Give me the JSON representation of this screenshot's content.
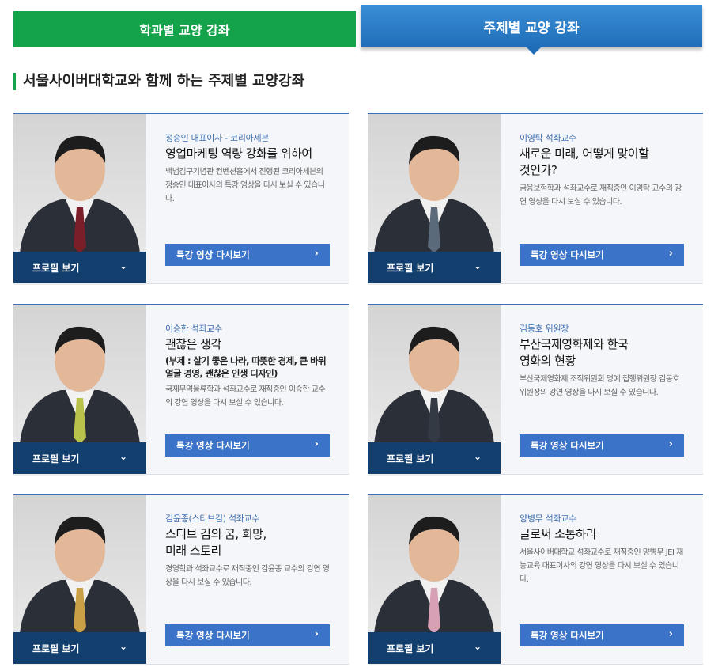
{
  "tabs": {
    "department": "학과별 교양 강좌",
    "topic": "주제별 교양 강좌"
  },
  "section_title": "서울사이버대학교와 함께 하는 주제별 교양강좌",
  "colors": {
    "green": "#14a24a",
    "blue": "#2d7cc5",
    "navy": "#123f6e",
    "button": "#3a73c8"
  },
  "cards": [
    {
      "speaker": "정승인 대표이사 - 코리아세븐",
      "title": "영업마케팅 역량 강화를 위하여",
      "subtitle": "",
      "description": "백범김구기념관 컨벤션홀에서 진행된 코리아세븐의 정승인 대표이사의 특강 영상을 다시 보실 수 있습니다.",
      "replay_label": "특강 영상 다시보기",
      "profile_label": "프로필 보기"
    },
    {
      "speaker": "이영탁 석좌교수",
      "title": "새로운 미래, 어떻게 맞이할 것인가?",
      "subtitle": "",
      "description": "금융보험학과 석좌교수로 재직중인 이영탁 교수의 강연 영상을 다시 보실 수 있습니다.",
      "replay_label": "특강 영상 다시보기",
      "profile_label": "프로필 보기"
    },
    {
      "speaker": "이승한 석좌교수",
      "title": "괜찮은 생각",
      "subtitle": "(부제 : 살기 좋은 나라, 따뜻한 경제, 큰 바위 얼굴 경영, 괜찮은 인생 디자인)",
      "description": "국제무역물류학과 석좌교수로 재직중인 이승한 교수의 강연 영상을 다시 보실 수 있습니다.",
      "replay_label": "특강 영상 다시보기",
      "profile_label": "프로필 보기"
    },
    {
      "speaker": "김동호 위원장",
      "title": "부산국제영화제와 한국영화의 현황",
      "subtitle": "",
      "description": "부산국제영화제 조직위원회 명예 집행위원장 김동호 위원장의 강연 영상을 다시 보실 수 있습니다.",
      "replay_label": "특강 영상 다시보기",
      "profile_label": "프로필 보기"
    },
    {
      "speaker": "김윤종(스티브김) 석좌교수",
      "title": "스티브 김의 꿈, 희망, 미래 스토리",
      "subtitle": "",
      "description": "경영학과 석좌교수로 재직중인 김윤종 교수의 강연 영상을 다시 보실 수 있습니다.",
      "replay_label": "특강 영상 다시보기",
      "profile_label": "프로필 보기"
    },
    {
      "speaker": "양병무 석좌교수",
      "title": "글로써 소통하라",
      "subtitle": "",
      "description": "서울사이버대학교 석좌교수로 재직중인 양병무 JEI 재능교육 대표이사의 강연 영상을 다시 보실 수 있습니다.",
      "replay_label": "특강 영상 다시보기",
      "profile_label": "프로필 보기"
    }
  ]
}
